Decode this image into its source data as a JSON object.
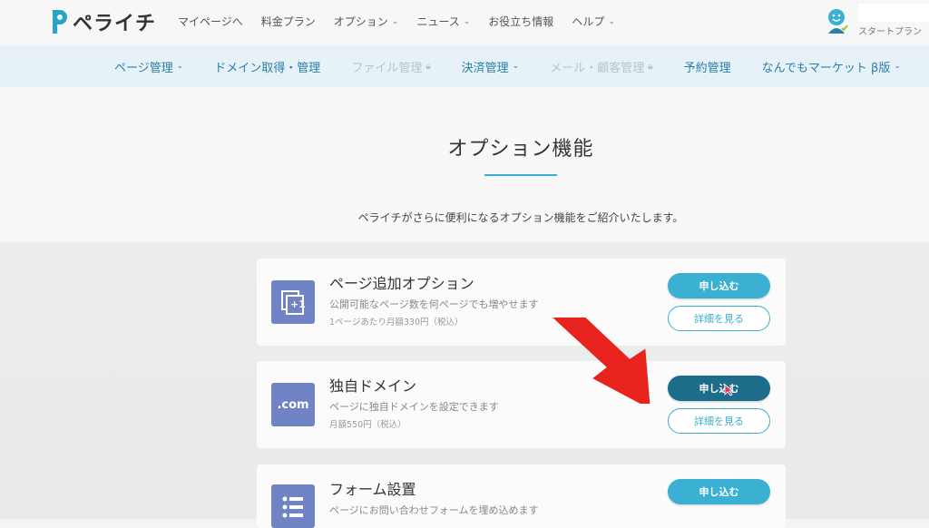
{
  "brand": {
    "name": "ペライチ",
    "color": "#2aa3c8"
  },
  "topnav": [
    {
      "label": "マイページへ",
      "dropdown": false
    },
    {
      "label": "料金プラン",
      "dropdown": false
    },
    {
      "label": "オプション",
      "dropdown": true
    },
    {
      "label": "ニュース",
      "dropdown": true
    },
    {
      "label": "お役立ち情報",
      "dropdown": false
    },
    {
      "label": "ヘルプ",
      "dropdown": true
    }
  ],
  "user": {
    "plan": "スタートプラン"
  },
  "subnav": [
    {
      "label": "ページ管理",
      "dropdown": true,
      "disabled": false
    },
    {
      "label": "ドメイン取得・管理",
      "dropdown": false,
      "disabled": false
    },
    {
      "label": "ファイル管理",
      "locked": true,
      "disabled": true
    },
    {
      "label": "決済管理",
      "dropdown": true,
      "disabled": false
    },
    {
      "label": "メール・顧客管理",
      "locked": true,
      "disabled": true
    },
    {
      "label": "予約管理",
      "dropdown": false,
      "disabled": false
    },
    {
      "label": "なんでもマーケット β版",
      "dropdown": true,
      "disabled": false
    }
  ],
  "page": {
    "title": "オプション機能",
    "lead": "ペライチがさらに便利になるオプション機能をご紹介いたします。"
  },
  "cards": [
    {
      "name": "ページ追加オプション",
      "desc": "公開可能なページ数を何ページでも増やせます",
      "price": "1ページあたり月額330円（税込）",
      "icon": "pages-plus-icon",
      "icon_text": "+1",
      "apply_label": "申し込む",
      "detail_label": "詳細を見る"
    },
    {
      "name": "独自ドメイン",
      "desc": "ページに独自ドメインを設定できます",
      "price": "月額550円（税込）",
      "icon": "domain-icon",
      "icon_text": ".com",
      "apply_label": "申し込む",
      "detail_label": "詳細を見る"
    },
    {
      "name": "フォーム設置",
      "desc": "ページにお問い合わせフォームを埋め込めます",
      "price": "",
      "icon": "form-list-icon",
      "icon_text": "",
      "apply_label": "申し込む",
      "detail_label": ""
    }
  ],
  "colors": {
    "accent": "#3ab0d3",
    "icon_bg": "#6f83c5",
    "arrow": "#e8231e",
    "sub_nav_text": "#2b7fa8"
  }
}
